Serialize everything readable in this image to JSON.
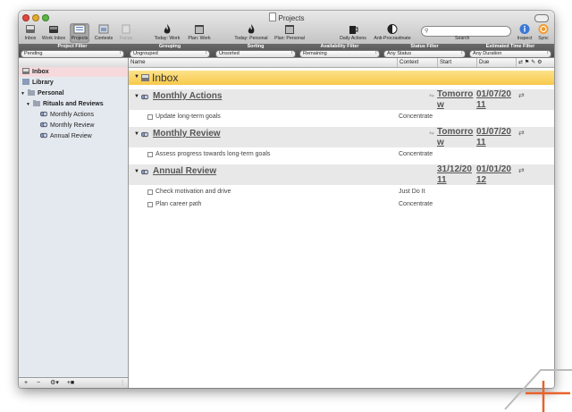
{
  "window": {
    "title": "Projects"
  },
  "toolbar": {
    "buttons": [
      {
        "label": "Inbox",
        "icon": "inbox-icon"
      },
      {
        "label": "Work Inbox",
        "icon": "work-inbox-icon"
      },
      {
        "label": "Projects",
        "icon": "projects-icon",
        "selected": true
      },
      {
        "label": "Contexts",
        "icon": "contexts-icon"
      },
      {
        "label": "Focus",
        "icon": "focus-icon",
        "disabled": true
      },
      {
        "label": "Today: Work",
        "icon": "flame-icon"
      },
      {
        "label": "Plan: Work",
        "icon": "calendar-icon"
      },
      {
        "label": "Today: Personal",
        "icon": "flame-icon"
      },
      {
        "label": "Plan: Personal",
        "icon": "calendar-icon"
      },
      {
        "label": "Daily Actions",
        "icon": "coffee-icon"
      },
      {
        "label": "Anti-Procrastinate",
        "icon": "half-circle-icon"
      }
    ],
    "search_label": "Search",
    "search_placeholder": "",
    "inspect_label": "Inspect",
    "sync_label": "Sync"
  },
  "filters": {
    "project_filter": {
      "label": "Project Filter",
      "value": "Pending"
    },
    "grouping": {
      "label": "Grouping",
      "value": "Ungrouped"
    },
    "sorting": {
      "label": "Sorting",
      "value": "Unsorted"
    },
    "availability": {
      "label": "Availability Filter",
      "value": "Remaining"
    },
    "status": {
      "label": "Status Filter",
      "value": "Any Status"
    },
    "estimated_time": {
      "label": "Estimated Time Filter",
      "value": "Any Duration"
    }
  },
  "sidebar": {
    "items": [
      {
        "label": "Inbox",
        "icon": "inbox-icon"
      },
      {
        "label": "Library",
        "icon": "library-icon"
      },
      {
        "label": "Personal",
        "icon": "folder-icon"
      },
      {
        "label": "Rituals and Reviews",
        "icon": "folder-icon"
      },
      {
        "label": "Monthly Actions",
        "icon": "project-icon"
      },
      {
        "label": "Monthly Review",
        "icon": "project-icon"
      },
      {
        "label": "Annual Review",
        "icon": "project-icon"
      }
    ],
    "bottom_buttons": [
      "+",
      "−",
      "⚙▾",
      "+■"
    ]
  },
  "columns": {
    "name": "Name",
    "context": "Context",
    "start": "Start",
    "due": "Due"
  },
  "main": {
    "inbox_title": "Inbox",
    "projects": [
      {
        "name": "Monthly Actions",
        "start": "Tomorrow",
        "due": "01/07/2011",
        "tasks": [
          {
            "name": "Update long-term goals",
            "context": "Concentrate"
          }
        ]
      },
      {
        "name": "Monthly Review",
        "start": "Tomorrow",
        "due": "01/07/2011",
        "tasks": [
          {
            "name": "Assess progress towards long-term goals",
            "context": "Concentrate"
          }
        ]
      },
      {
        "name": "Annual Review",
        "start": "31/12/2011",
        "due": "01/01/2012",
        "tasks": [
          {
            "name": "Check motivation and drive",
            "context": "Just Do It"
          },
          {
            "name": "Plan career path",
            "context": "Concentrate"
          }
        ]
      }
    ]
  },
  "colors": {
    "accent": "#f7c94b",
    "selection": "#f5d9dc",
    "sidebar": "#e4e9ef",
    "logo": "#e8622c"
  }
}
